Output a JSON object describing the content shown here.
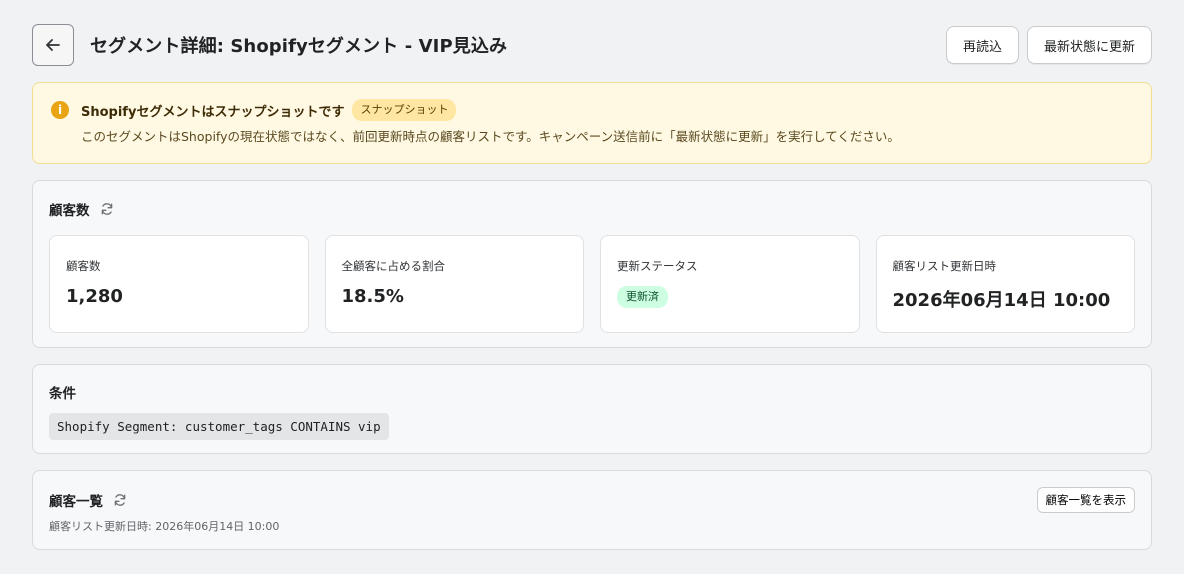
{
  "header": {
    "title": "セグメント詳細: Shopifyセグメント - VIP見込み",
    "reload_label": "再読込",
    "refresh_latest_label": "最新状態に更新"
  },
  "banner": {
    "title": "Shopifyセグメントはスナップショットです",
    "badge": "スナップショット",
    "body": "このセグメントはShopifyの現在状態ではなく、前回更新時点の顧客リストです。キャンペーン送信前に「最新状態に更新」を実行してください。",
    "icon": "info-icon",
    "color": "#e8a412"
  },
  "counts": {
    "title": "顧客数",
    "stats": [
      {
        "label": "顧客数",
        "value": "1,280"
      },
      {
        "label": "全顧客に占める割合",
        "value": "18.5%"
      },
      {
        "label": "更新ステータス",
        "value": "更新済"
      },
      {
        "label": "顧客リスト更新日時",
        "value": "2026年06月14日 10:00"
      }
    ]
  },
  "conditions": {
    "title": "条件",
    "query": "Shopify Segment: customer_tags CONTAINS vip"
  },
  "customers": {
    "title": "顧客一覧",
    "show_button": "顧客一覧を表示",
    "updated_text": "顧客リスト更新日時: 2026年06月14日 10:00"
  }
}
